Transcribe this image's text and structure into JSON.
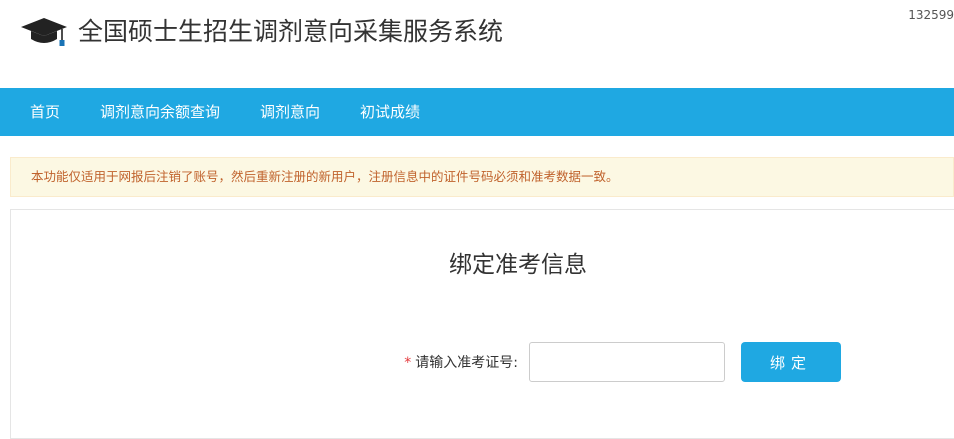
{
  "header": {
    "logo_icon": "graduation-cap-icon",
    "title": "全国硕士生招生调剂意向采集服务系统",
    "counter": "132599"
  },
  "nav": {
    "items": [
      {
        "label": "首页"
      },
      {
        "label": "调剂意向余额查询"
      },
      {
        "label": "调剂意向"
      },
      {
        "label": "初试成绩"
      }
    ],
    "background_color": "#1fa8e2"
  },
  "notice": {
    "text": "本功能仅适用于网报后注销了账号，然后重新注册的新用户，注册信息中的证件号码必须和准考数据一致。"
  },
  "bind_form": {
    "title": "绑定准考信息",
    "required_mark": "*",
    "label": "请输入准考证号:",
    "input_value": "",
    "input_placeholder": "",
    "submit_label": "绑定"
  },
  "colors": {
    "accent": "#1fa8e2",
    "notice_text": "#c0622c",
    "notice_bg": "#fcf8e3",
    "required": "#e4393c"
  }
}
